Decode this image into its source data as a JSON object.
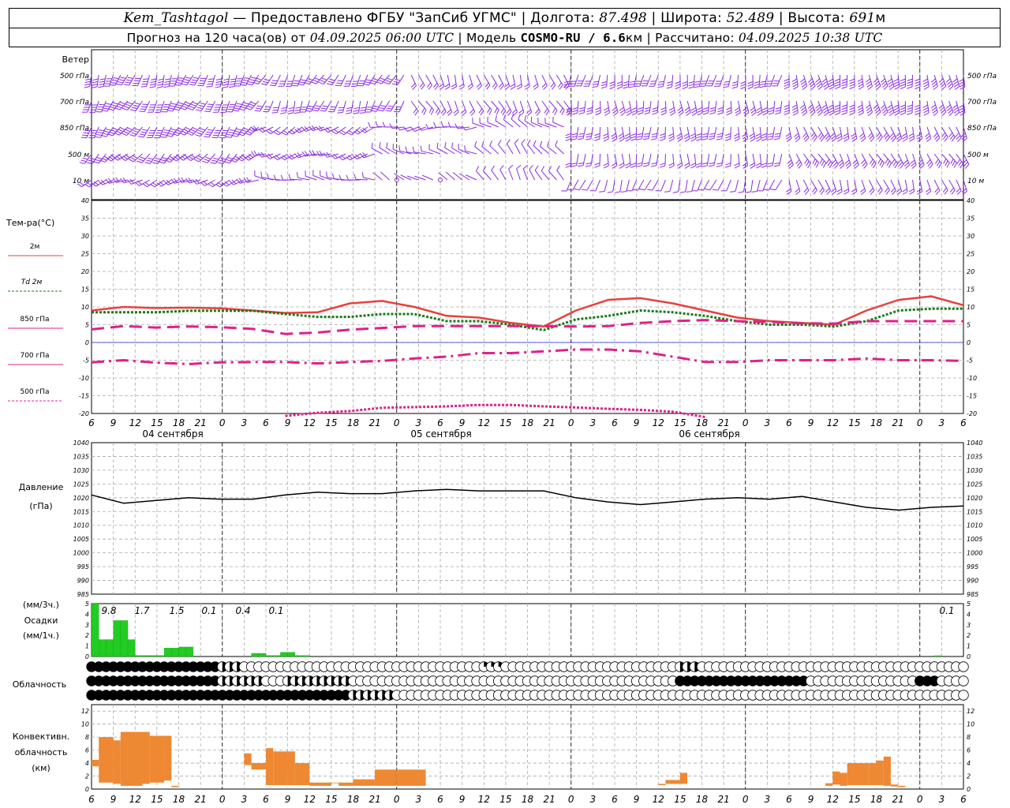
{
  "header": {
    "station": "Kem_Tashtagol",
    "provider": "— Предоставлено ФГБУ \"ЗапСиб УГМС\"",
    "lon_label": "Долгота:",
    "lon": "87.498",
    "lat_label": "Широта:",
    "lat": "52.489",
    "alt_label": "Высота:",
    "alt": "691",
    "alt_unit": "м",
    "forecast_label": "Прогноз на 120 часа(ов) от",
    "forecast_start": "04.09.2025 06:00 UTC",
    "model_label": "Модель",
    "model": "COSMO-RU / 6.6",
    "model_unit": "км",
    "calc_label": "Рассчитано:",
    "calc_time": "04.09.2025 10:38 UTC"
  },
  "labels": {
    "wind_title": "Ветер",
    "wind_levels": [
      "500 гПа",
      "700 гПа",
      "850 гПа",
      "500 м",
      "10  м"
    ],
    "temp_title": "Тем-ра(°С)",
    "temp_legend": [
      "2м",
      "Td  2м",
      "850 гПа",
      "700 гПа",
      "500 гПа"
    ],
    "pres_title": [
      "Давление",
      "(гПа)"
    ],
    "precip_title": [
      "(мм/3ч.)",
      "Осадки",
      "(мм/1ч.)"
    ],
    "cloud_title": "Облачность",
    "conv_title": [
      "Конвективн.",
      "облачность",
      "(км)"
    ],
    "dates": [
      "04 сентября",
      "05 сентября",
      "06 сентября"
    ]
  },
  "colors": {
    "wind": "#8a2be2",
    "t2m": "#e8403c",
    "td2m": "#1a7a1a",
    "t850": "#e0208a",
    "t700": "#e0208a",
    "t500": "#e0208a",
    "zero_line": "#2020e0",
    "precip": "#22cc22",
    "convective": "#ee8833"
  },
  "chart_data": [
    {
      "type": "line",
      "title": "Тем-ра(°С)",
      "x": [
        6,
        9,
        12,
        15,
        18,
        21,
        24,
        27,
        30,
        33,
        36,
        39,
        42,
        45,
        48,
        51,
        54,
        57,
        60,
        63,
        66,
        69,
        72,
        75,
        78,
        81,
        84,
        87,
        90,
        93,
        96,
        99,
        102,
        105,
        108,
        111,
        114,
        117,
        120,
        123,
        126
      ],
      "x_tick_labels": [
        "6",
        "9",
        "12",
        "15",
        "18",
        "21",
        "0",
        "3",
        "6",
        "9",
        "12",
        "15",
        "18",
        "21",
        "0",
        "3",
        "6",
        "9",
        "12",
        "15",
        "18",
        "21",
        "0",
        "3",
        "6",
        "9",
        "12"
      ],
      "ylim": [
        -20,
        40
      ],
      "series": [
        {
          "name": "2м",
          "style": "solid",
          "values": [
            9,
            10,
            9.7,
            9.8,
            9.6,
            9,
            8.3,
            8.5,
            11,
            11.7,
            10,
            7.5,
            7,
            5.5,
            4.5,
            9,
            12,
            12.5,
            11,
            9,
            7,
            6,
            5.5,
            5,
            9,
            12,
            13,
            10.5
          ]
        },
        {
          "name": "Td  2м",
          "style": "dotted",
          "values": [
            8.5,
            8.5,
            8.5,
            8.9,
            8.9,
            8.9,
            8,
            7.2,
            7.2,
            8,
            8,
            6,
            6,
            5,
            3.5,
            6.5,
            7.5,
            9,
            8.5,
            7.5,
            6,
            5,
            5,
            4.5,
            6,
            9,
            9.5,
            9.5
          ]
        },
        {
          "name": "850 гПа",
          "style": "dashed",
          "values": [
            3.7,
            4.6,
            4.2,
            4.5,
            4.3,
            3.8,
            2.4,
            2.8,
            3.6,
            4.1,
            4.6,
            4.6,
            4.6,
            4.6,
            4.6,
            4.5,
            4.6,
            5.5,
            6,
            6.3,
            6,
            5.8,
            5.4,
            5.3,
            6,
            6,
            6,
            6
          ]
        },
        {
          "name": "700 гПа",
          "style": "dashdot",
          "values": [
            -5.6,
            -5,
            -5.7,
            -6.1,
            -5.6,
            -5.5,
            -5.5,
            -5.9,
            -5.5,
            -5.2,
            -4.5,
            -4,
            -3,
            -3,
            -2.5,
            -2,
            -2,
            -2.5,
            -4,
            -5.5,
            -5.5,
            -5,
            -5,
            -5,
            -4.5,
            -5,
            -5,
            -5.2
          ]
        },
        {
          "name": "500 гПа",
          "style": "dotted",
          "values": [
            null,
            null,
            null,
            null,
            null,
            null,
            -20.7,
            -19.8,
            -19.3,
            -18.4,
            -18.2,
            -18,
            -17.6,
            -17.6,
            -18,
            -18.3,
            -18.7,
            -19,
            -19.5,
            -21,
            null,
            null,
            null,
            null,
            null,
            null,
            null,
            null
          ]
        }
      ]
    },
    {
      "type": "line",
      "title": "Давление (гПа)",
      "ylim": [
        985,
        1040
      ],
      "series": [
        {
          "name": "Давление",
          "values": [
            1021,
            1018,
            1019,
            1020,
            1019.5,
            1019.5,
            1021,
            1022,
            1021.5,
            1021.5,
            1022.5,
            1023,
            1022.5,
            1022.5,
            1022.5,
            1020,
            1018.5,
            1017.5,
            1018.5,
            1019.5,
            1020,
            1019.5,
            1020.5,
            1018.5,
            1016.5,
            1015.5,
            1016.5,
            1017
          ]
        }
      ]
    },
    {
      "type": "bar",
      "title": "Осадки",
      "ylim": [
        0,
        5
      ],
      "hourly": [
        5,
        1.6,
        1.6,
        3.4,
        3.4,
        1.6,
        0.1,
        0.1,
        0.1,
        0.1,
        0.8,
        0.8,
        0.9,
        0.9,
        0,
        0,
        0,
        0,
        0,
        0,
        0,
        0,
        0.3,
        0.3,
        0.1,
        0.1,
        0.4,
        0.4,
        0.1,
        0.1
      ],
      "hourly_tail": [
        0.1
      ],
      "three_hour_labels": [
        "9.8",
        "1.7",
        "1.5",
        "0.1",
        "0.4",
        "0.1",
        "0.1"
      ]
    },
    {
      "type": "bar",
      "title": "Конвективн. облачность (км)",
      "ylim": [
        0,
        12
      ],
      "layers": [
        [
          6,
          3.5,
          4.5
        ],
        [
          7,
          1,
          8
        ],
        [
          9,
          0.8,
          7.5
        ],
        [
          10,
          0.5,
          8.8
        ],
        [
          13,
          0.8,
          8.8
        ],
        [
          14,
          1,
          8.2
        ],
        [
          16,
          1.3,
          8.2
        ],
        [
          17,
          0.3,
          0.5
        ],
        [
          27,
          3.7,
          5.5
        ],
        [
          28,
          3,
          4
        ],
        [
          30,
          0.6,
          6.3
        ],
        [
          31,
          0.6,
          5.8
        ],
        [
          33,
          0.6,
          5.8
        ],
        [
          34,
          0.6,
          4
        ],
        [
          36,
          0.5,
          1
        ],
        [
          39,
          0.9,
          1
        ],
        [
          40,
          0.5,
          1
        ],
        [
          42,
          0.5,
          1.5
        ],
        [
          45,
          0.5,
          3
        ],
        [
          48,
          0.5,
          3
        ],
        [
          51,
          0.5,
          3
        ],
        [
          84,
          0.6,
          0.8
        ],
        [
          85,
          0.8,
          1.4
        ],
        [
          87,
          0.8,
          2.5
        ],
        [
          107,
          0.5,
          0.9
        ],
        [
          108,
          0.7,
          2.7
        ],
        [
          109,
          0.5,
          2.5
        ],
        [
          110,
          0.6,
          4
        ],
        [
          113,
          0.6,
          4
        ],
        [
          114,
          0.6,
          4.4
        ],
        [
          115,
          0.5,
          5
        ],
        [
          116,
          0.4,
          0.7
        ],
        [
          117,
          0.3,
          0.5
        ]
      ]
    }
  ]
}
